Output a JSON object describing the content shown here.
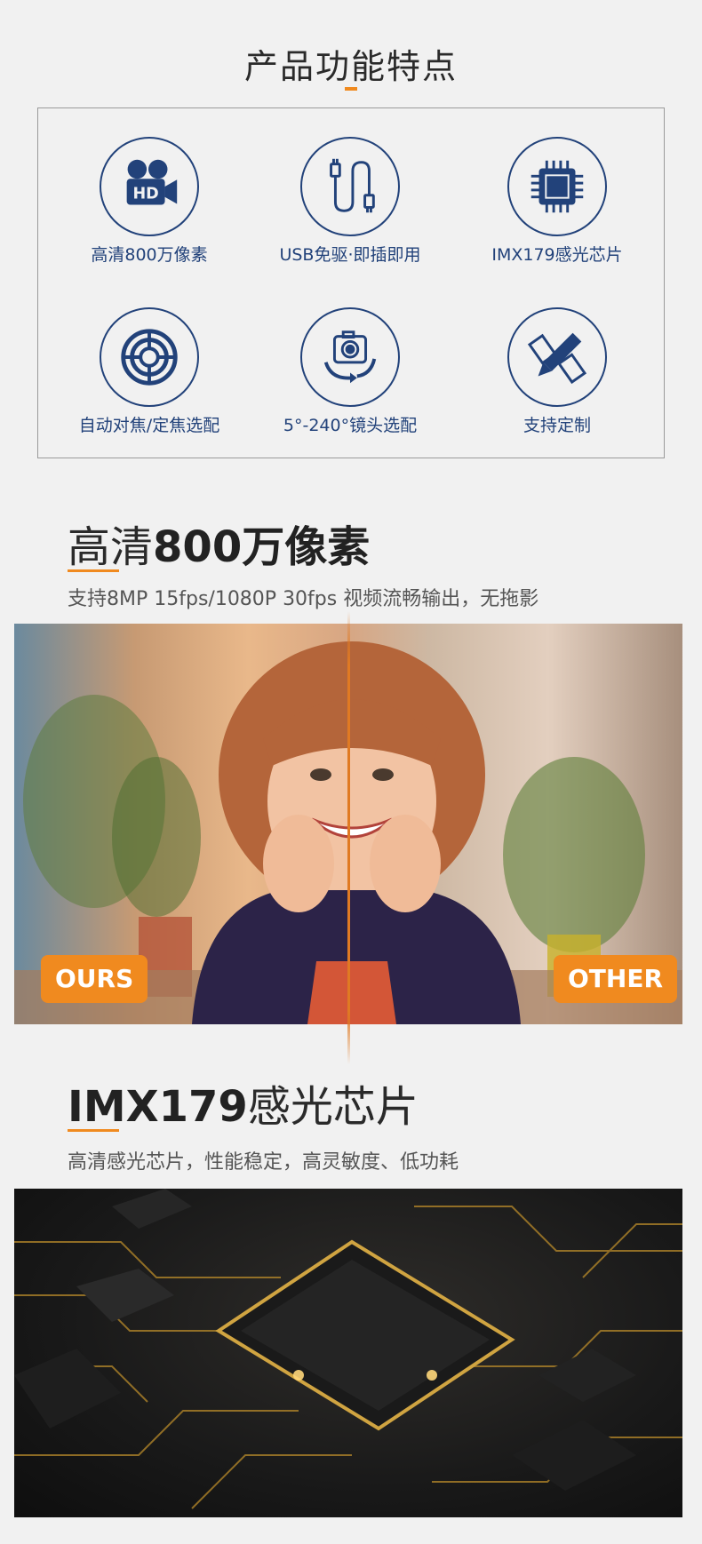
{
  "features_section": {
    "title": "产品功能特点",
    "items": [
      {
        "label": "高清800万像素",
        "icon": "hd-camera-icon"
      },
      {
        "label": "USB免驱·即插即用",
        "icon": "usb-cable-icon"
      },
      {
        "label": "IMX179感光芯片",
        "icon": "chip-icon"
      },
      {
        "label": "自动对焦/定焦选配",
        "icon": "lens-focus-icon"
      },
      {
        "label": "5°-240°镜头选配",
        "icon": "camera-rotate-icon"
      },
      {
        "label": "支持定制",
        "icon": "pencil-ruler-icon"
      }
    ],
    "accent_color": "#f08a1f",
    "icon_color": "#22427a"
  },
  "hd_section": {
    "title_bold": "800万像素",
    "title_light": "高清",
    "subtitle": "支持8MP 15fps/1080P 30fps 视频流畅输出，无拖影",
    "badge_left": "OURS",
    "badge_right": "OTHER"
  },
  "sensor_section": {
    "title_bold": "IMX179",
    "title_light": "感光芯片",
    "subtitle": "高清感光芯片，性能稳定，高灵敏度、低功耗"
  }
}
